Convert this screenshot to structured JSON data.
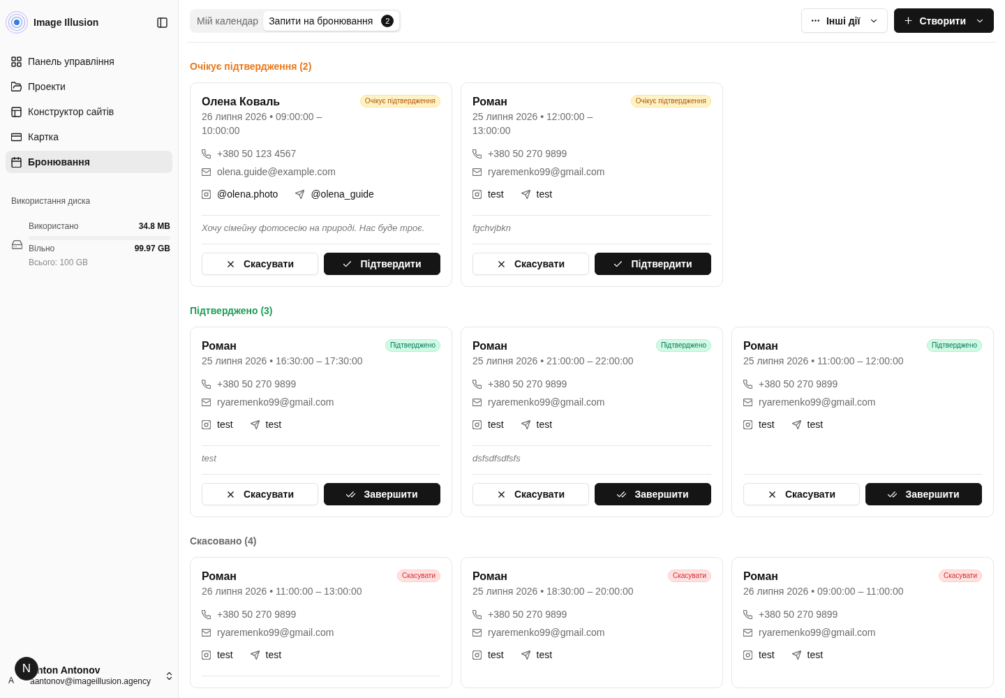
{
  "sidebar": {
    "brand": "Image Illusion",
    "nav": [
      {
        "label": "Панель управління",
        "selected": false
      },
      {
        "label": "Проекти",
        "selected": false
      },
      {
        "label": "Конструктор сайтів",
        "selected": false
      },
      {
        "label": "Картка",
        "selected": false
      },
      {
        "label": "Бронювання",
        "selected": true
      }
    ],
    "disk": {
      "title": "Використання диска",
      "used_label": "Використано",
      "used_value": "34.8 MB",
      "level": 0.0003,
      "free_label": "Вільно",
      "free_value": "99.97 GB",
      "total": "Всього: 100 GB"
    },
    "user": {
      "avatar_letter": "A",
      "name": "nton Antonov",
      "email": "aantonov@imageillusion.agency"
    }
  },
  "dev_indicator": {
    "label": "N"
  },
  "tabs": [
    {
      "label": "Мій календар",
      "selected": false
    },
    {
      "label": "Запити на бронювання",
      "selected": true,
      "count": "2"
    }
  ],
  "actions": [
    {
      "kind": "more",
      "label": "Інші дії"
    },
    {
      "kind": "create",
      "label": "Створити"
    }
  ],
  "sections": [
    {
      "kind": "pending",
      "title": "Очікує підтвердження (2)",
      "cards": [
        {
          "name": "Олена Коваль",
          "badge": "Очікує підтвердження",
          "date": "26 липня 2026 • 09:00:00 – 10:00:00",
          "phone": "+380 50 123 4567",
          "email": "olena.guide@example.com",
          "instagram": "@olena.photo",
          "telegram": "@olena_guide",
          "has_note": true,
          "note": "Хочу сімейну фотосесію на природі. Нас буде троє.",
          "buttons": [
            {
              "kind": "cancel",
              "label": "Скасувати"
            },
            {
              "kind": "confirm",
              "label": "Підтвердити"
            }
          ]
        },
        {
          "name": "Роман",
          "badge": "Очікує підтвердження",
          "date": "25 липня 2026 • 12:00:00 – 13:00:00",
          "phone": "+380 50 270 9899",
          "email": "ryaremenko99@gmail.com",
          "instagram": "test",
          "telegram": "test",
          "has_note": true,
          "note": "fgchvjbkn",
          "buttons": [
            {
              "kind": "cancel",
              "label": "Скасувати"
            },
            {
              "kind": "confirm",
              "label": "Підтвердити"
            }
          ]
        }
      ]
    },
    {
      "kind": "confirmed",
      "title": "Підтверджено (3)",
      "cards": [
        {
          "name": "Роман",
          "badge": "Підтверджено",
          "date": "25 липня 2026 • 16:30:00 – 17:30:00",
          "phone": "+380 50 270 9899",
          "email": "ryaremenko99@gmail.com",
          "instagram": "test",
          "telegram": "test",
          "has_note": true,
          "note": "test",
          "buttons": [
            {
              "kind": "cancel",
              "label": "Скасувати"
            },
            {
              "kind": "complete",
              "label": "Завершити"
            }
          ]
        },
        {
          "name": "Роман",
          "badge": "Підтверджено",
          "date": "25 липня 2026 • 21:00:00 – 22:00:00",
          "phone": "+380 50 270 9899",
          "email": "ryaremenko99@gmail.com",
          "instagram": "test",
          "telegram": "test",
          "has_note": true,
          "note": "dsfsdfsdfsfs",
          "buttons": [
            {
              "kind": "cancel",
              "label": "Скасувати"
            },
            {
              "kind": "complete",
              "label": "Завершити"
            }
          ]
        },
        {
          "name": "Роман",
          "badge": "Підтверджено",
          "date": "25 липня 2026 • 11:00:00 – 12:00:00",
          "phone": "+380 50 270 9899",
          "email": "ryaremenko99@gmail.com",
          "instagram": "test",
          "telegram": "test",
          "has_note": false,
          "buttons": [
            {
              "kind": "cancel",
              "label": "Скасувати"
            },
            {
              "kind": "complete",
              "label": "Завершити"
            }
          ]
        }
      ]
    },
    {
      "kind": "cancelled",
      "title": "Скасовано (4)",
      "cards": [
        {
          "name": "Роман",
          "badge": "Скасувати",
          "date": "26 липня 2026 • 11:00:00 – 13:00:00",
          "phone": "+380 50 270 9899",
          "email": "ryaremenko99@gmail.com",
          "instagram": "test",
          "telegram": "test",
          "has_note": true
        },
        {
          "name": "Роман",
          "badge": "Скасувати",
          "date": "25 липня 2026 • 18:30:00 – 20:00:00",
          "phone": "+380 50 270 9899",
          "email": "ryaremenko99@gmail.com",
          "instagram": "test",
          "telegram": "test",
          "has_note": false
        },
        {
          "name": "Роман",
          "badge": "Скасувати",
          "date": "26 липня 2026 • 09:00:00 – 11:00:00",
          "phone": "+380 50 270 9899",
          "email": "ryaremenko99@gmail.com",
          "instagram": "test",
          "telegram": "test",
          "has_note": false
        }
      ]
    }
  ]
}
